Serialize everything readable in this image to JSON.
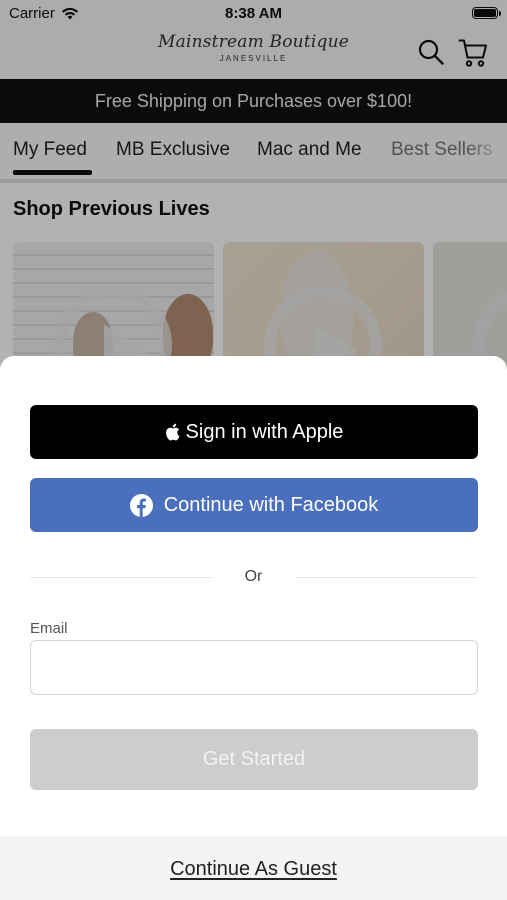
{
  "status_bar": {
    "carrier": "Carrier",
    "time": "8:38 AM"
  },
  "header": {
    "logo_name": "Mainstream Boutique",
    "logo_city": "JANESVILLE",
    "icons": [
      "search-icon",
      "cart-icon"
    ]
  },
  "promo": {
    "text": "Free Shipping on Purchases over $100!"
  },
  "tabs": [
    {
      "label": "My Feed",
      "selected": true
    },
    {
      "label": "MB Exclusive",
      "selected": false
    },
    {
      "label": "Mac and Me",
      "selected": false
    },
    {
      "label": "Best Sellers",
      "selected": false
    }
  ],
  "feed": {
    "section_title": "Shop Previous Lives"
  },
  "sheet": {
    "apple_label": "Sign in with Apple",
    "facebook_label": "Continue with Facebook",
    "or_label": "Or",
    "email_label": "Email",
    "email_value": "",
    "get_started_label": "Get Started",
    "guest_label": "Continue As Guest"
  },
  "colors": {
    "facebook_blue": "#4a6fbd",
    "apple_black": "#000000",
    "disabled_gray": "#cdcdcd",
    "promo_bg": "#111111"
  }
}
